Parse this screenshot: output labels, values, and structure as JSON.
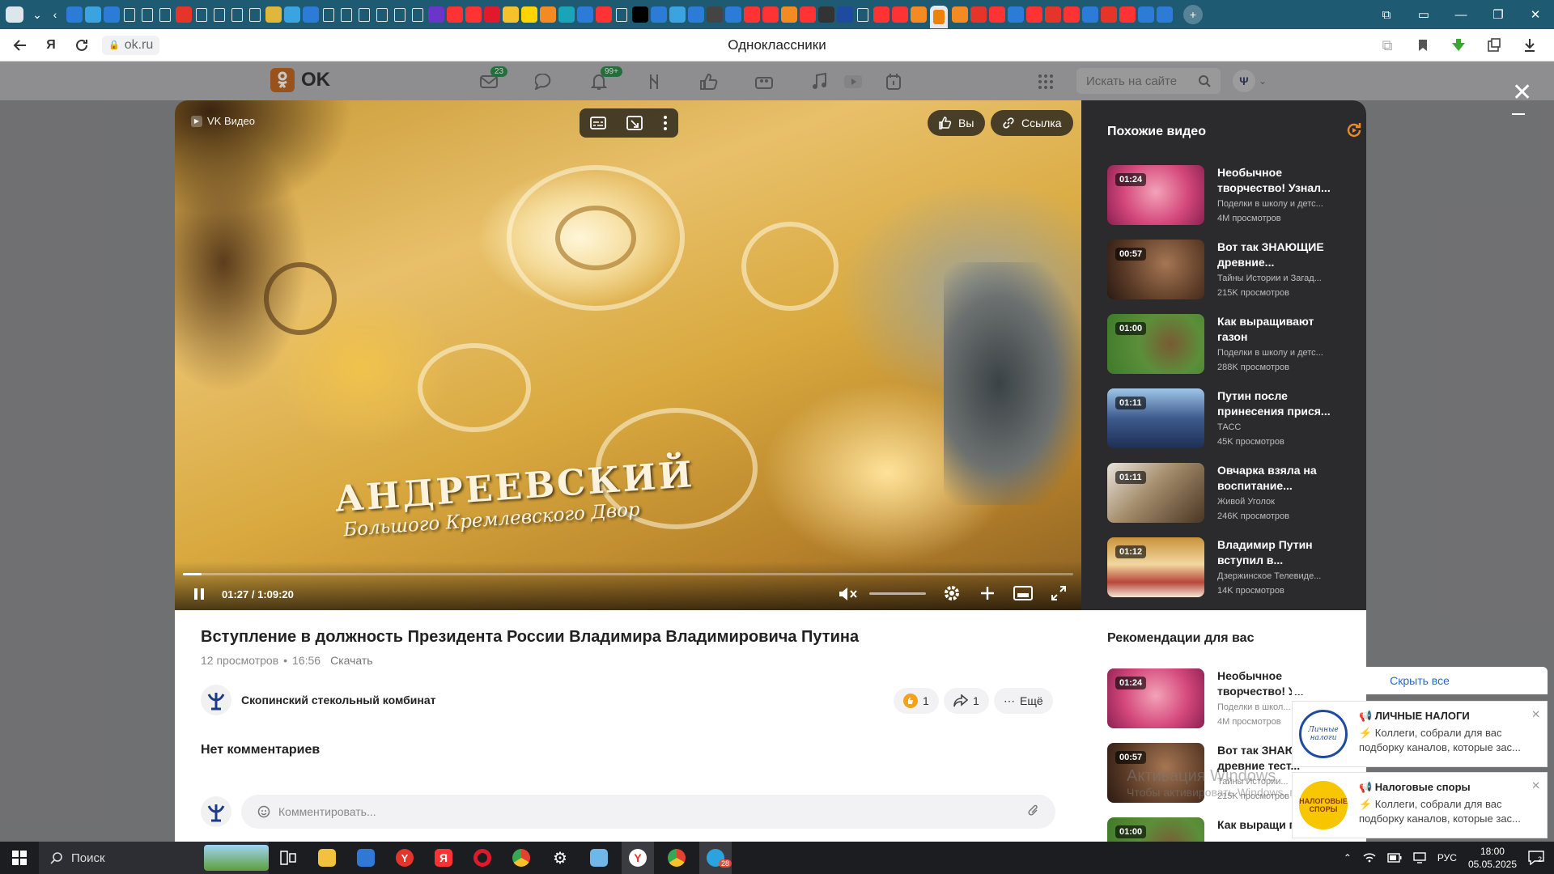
{
  "browser": {
    "page_title": "Одноклассники",
    "url": "ok.ru"
  },
  "header": {
    "logo_text": "OK",
    "messages_badge": "23",
    "notifications_badge": "99+",
    "search_placeholder": "Искать на сайте"
  },
  "player": {
    "brand": "VK Видео",
    "caption_line1": "АНДРЕЕВСКИЙ",
    "caption_line2": "Большого Кремлевского Двор",
    "time": "01:27 / 1:09:20",
    "progress_fraction": 0.021,
    "like_label": "Вы",
    "link_label": "Ссылка"
  },
  "video": {
    "title": "Вступление в должность Президента России Владимира Владимировича Путина",
    "views": "12 просмотров",
    "time": "16:56",
    "download": "Скачать",
    "author": "Скопинский стекольный комбинат",
    "likes": "1",
    "shares": "1",
    "more": "Ещё",
    "no_comments": "Нет комментариев",
    "comment_placeholder": "Комментировать..."
  },
  "similar": {
    "title": "Похожие видео",
    "items": [
      {
        "dur": "01:24",
        "title": "Необычное творчество! Узнал...",
        "channel": "Поделки в школу и детс...",
        "views": "4М просмотров"
      },
      {
        "dur": "00:57",
        "title": "Вот так ЗНАЮЩИЕ древние...",
        "channel": "Тайны Истории и Загад...",
        "views": "215K просмотров"
      },
      {
        "dur": "01:00",
        "title": "Как выращивают газон",
        "channel": "Поделки в школу и детс...",
        "views": "288K просмотров"
      },
      {
        "dur": "01:11",
        "title": "Путин после принесения прися...",
        "channel": "ТАСС",
        "views": "45K просмотров"
      },
      {
        "dur": "01:11",
        "title": "Овчарка взяла на воспитание...",
        "channel": "Живой Уголок",
        "views": "246K просмотров"
      },
      {
        "dur": "01:12",
        "title": "Владимир Путин вступил в...",
        "channel": "Дзержинское Телевиде...",
        "views": "14K просмотров"
      }
    ]
  },
  "recommendations": {
    "title": "Рекомендации для вас",
    "items": [
      {
        "dur": "01:24",
        "title": "Необычное творчество! У...",
        "channel": "Поделки в школ...",
        "views": "4М просмотров"
      },
      {
        "dur": "00:57",
        "title": "Вот так ЗНАЮ древние тест...",
        "channel": "Тайны Истории...",
        "views": "215K просмотров"
      },
      {
        "dur": "01:00",
        "title": "Как выращи газон",
        "channel": "",
        "views": ""
      }
    ]
  },
  "watermark": {
    "line1": "Активация Windows",
    "line2": "Чтобы активировать Windows, перейдите в раздел \"Параметры\"."
  },
  "notifications": {
    "header": "Скрыть все",
    "items": [
      {
        "logo": "Личные налоги",
        "title": "📢 ЛИЧНЫЕ НАЛОГИ",
        "text": "⚡ Коллеги, собрали для вас подборку каналов, которые зас..."
      },
      {
        "logo": "НАЛОГОВЫЕ СПОРЫ",
        "title": "📢 Налоговые споры",
        "text": "⚡ Коллеги, собрали для вас подборку каналов, которые зас..."
      }
    ]
  },
  "taskbar": {
    "search": "Поиск",
    "lang": "РУС",
    "time": "18:00",
    "date": "05.05.2025",
    "telegram_badge": "28",
    "notif_count": "2"
  }
}
